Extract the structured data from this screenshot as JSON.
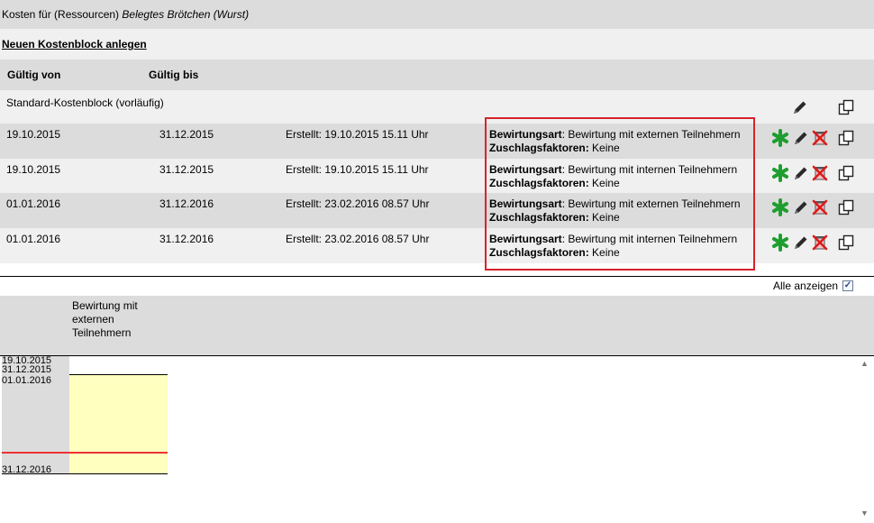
{
  "title": {
    "prefix": "Kosten für (Ressourcen)",
    "resource": "Belegtes Brötchen (Wurst)"
  },
  "new_block_link": "Neuen Kostenblock anlegen",
  "columns": {
    "valid_from": "Gültig von",
    "valid_to": "Gültig bis"
  },
  "standard_block": "Standard-Kostenblock (vorläufig)",
  "rows": [
    {
      "from": "19.10.2015",
      "to": "31.12.2015",
      "created": "Erstellt: 19.10.2015 15.11 Uhr",
      "bew_label": "Bewirtungsart",
      "bew_value": ": Bewirtung mit externen Teilnehmern",
      "zus_label": "Zuschlagsfaktoren:",
      "zus_value": " Keine"
    },
    {
      "from": "19.10.2015",
      "to": "31.12.2015",
      "created": "Erstellt: 19.10.2015 15.11 Uhr",
      "bew_label": "Bewirtungsart",
      "bew_value": ": Bewirtung mit internen Teilnehmern",
      "zus_label": "Zuschlagsfaktoren:",
      "zus_value": " Keine"
    },
    {
      "from": "01.01.2016",
      "to": "31.12.2016",
      "created": "Erstellt: 23.02.2016 08.57 Uhr",
      "bew_label": "Bewirtungsart",
      "bew_value": ": Bewirtung mit externen Teilnehmern",
      "zus_label": "Zuschlagsfaktoren:",
      "zus_value": " Keine"
    },
    {
      "from": "01.01.2016",
      "to": "31.12.2016",
      "created": "Erstellt: 23.02.2016 08.57 Uhr",
      "bew_label": "Bewirtungsart",
      "bew_value": ": Bewirtung mit internen Teilnehmern",
      "zus_label": "Zuschlagsfaktoren:",
      "zus_value": " Keine"
    }
  ],
  "show_all": {
    "label": "Alle anzeigen",
    "checked": true
  },
  "timeline": {
    "column_label": "Bewirtung mit externen Teilnehmern",
    "axis_labels": [
      "19.10.2015",
      "31.12.2015",
      "01.01.2016",
      "31.12.2016"
    ]
  },
  "icons": {
    "add": "asterisk-icon",
    "edit": "pencil-icon",
    "delete": "delete-icon",
    "copy": "copy-icon"
  },
  "colors": {
    "highlight": "#d9232a",
    "add_icon": "#1e9e2e",
    "bar": "#ffffc0",
    "marker": "#ee3333"
  }
}
